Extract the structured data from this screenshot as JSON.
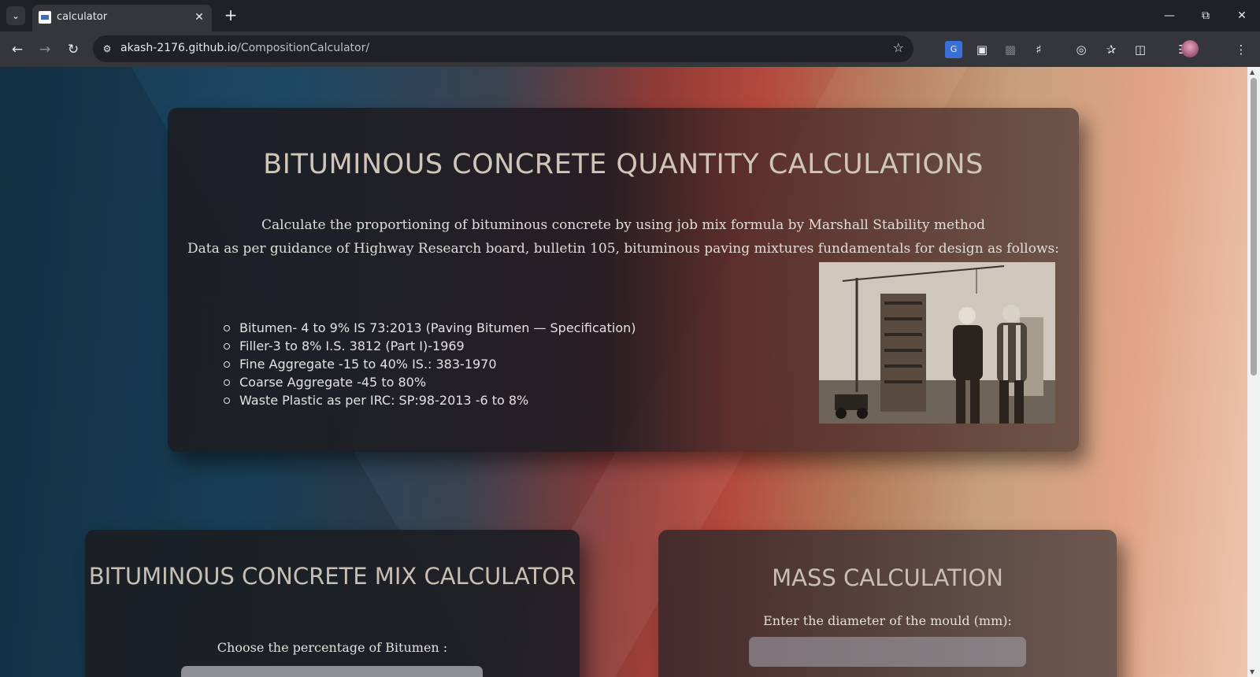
{
  "browser": {
    "tab_title": "calculator",
    "url_host": "akash-2176.github.io",
    "url_path": "/CompositionCalculator/"
  },
  "hero": {
    "title": "BITUMINOUS CONCRETE QUANTITY CALCULATIONS",
    "subtitle_1": "Calculate the proportioning of bituminous concrete by using job mix formula by Marshall Stability method",
    "subtitle_2": "Data as per guidance of Highway Research board, bulletin 105, bituminous paving mixtures fundamentals for design as follows:",
    "items": [
      "Bitumen- 4 to 9% IS 73:2013 (Paving Bitumen — Specification)",
      "Filler-3 to 8% I.S. 3812 (Part I)-1969",
      "Fine Aggregate -15 to 40% IS.: 383-1970",
      "Coarse Aggregate -45 to 80%",
      "Waste Plastic as per IRC: SP:98-2013 -6 to 8%"
    ]
  },
  "calculator": {
    "title": "BITUMINOUS CONCRETE MIX CALCULATOR",
    "bitumen_label": "Choose the percentage of Bitumen :"
  },
  "mass": {
    "title": "MASS CALCULATION",
    "diameter_label": "Enter the diameter of the mould (mm):"
  }
}
